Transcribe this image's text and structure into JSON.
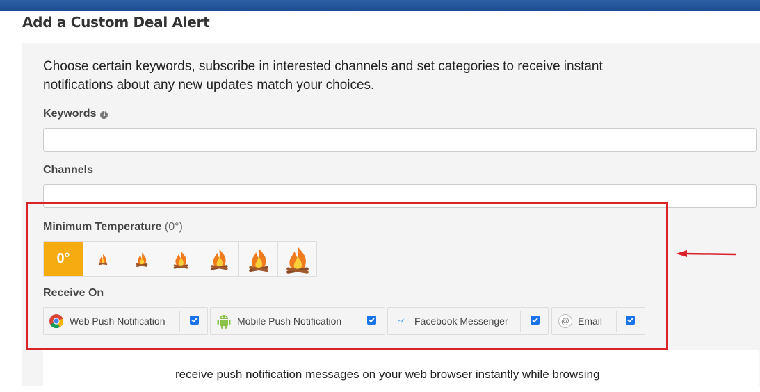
{
  "page": {
    "title": "Add a Custom Deal Alert"
  },
  "intro": {
    "line1": "Choose certain keywords, subscribe in interested channels and set categories to receive instant",
    "line2": "notifications about any new updates match your choices."
  },
  "keywords": {
    "label": "Keywords",
    "info_icon": "info-circle-icon",
    "value": ""
  },
  "channels_field": {
    "label": "Channels",
    "value": ""
  },
  "temperature": {
    "label": "Minimum Temperature",
    "current": "(0°)",
    "selected_label": "0°",
    "levels": [
      "0°",
      "fire-1",
      "fire-2",
      "fire-3",
      "fire-4",
      "fire-5",
      "fire-6"
    ],
    "accent_color": "#f4ac11"
  },
  "receive_on": {
    "label": "Receive On",
    "options": [
      {
        "label": "Web Push Notification",
        "icon": "chrome-icon",
        "checked": true
      },
      {
        "label": "Mobile Push Notification",
        "icon": "android-icon",
        "checked": true
      },
      {
        "label": "Facebook Messenger",
        "icon": "messenger-icon",
        "checked": true
      },
      {
        "label": "Email",
        "icon": "at-sign-icon",
        "checked": true
      }
    ]
  },
  "description": "receive push notification messages on your web browser instantly while browsing",
  "annotation": {
    "box_color": "#d9232a"
  }
}
